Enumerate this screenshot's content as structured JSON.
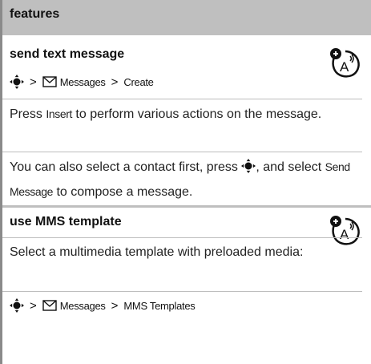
{
  "header": {
    "title": "features"
  },
  "sections": [
    {
      "title": "send text message",
      "icon": "network-antenna-icon",
      "path": {
        "messages": "Messages",
        "sep": ">",
        "create": "Create"
      },
      "p1": {
        "pre": "Press ",
        "key": "Insert",
        "post": " to perform various actions on the message."
      },
      "p2": {
        "pre": "You can also select a contact first, press ",
        "mid": ", and select ",
        "key": "Send Message",
        "post": " to compose a message."
      }
    },
    {
      "title": "use MMS template",
      "icon": "network-antenna-icon",
      "p1": "Select a multimedia template with preloaded media:",
      "path": {
        "messages": "Messages",
        "sep": ">",
        "templates": "MMS Templates"
      }
    }
  ]
}
